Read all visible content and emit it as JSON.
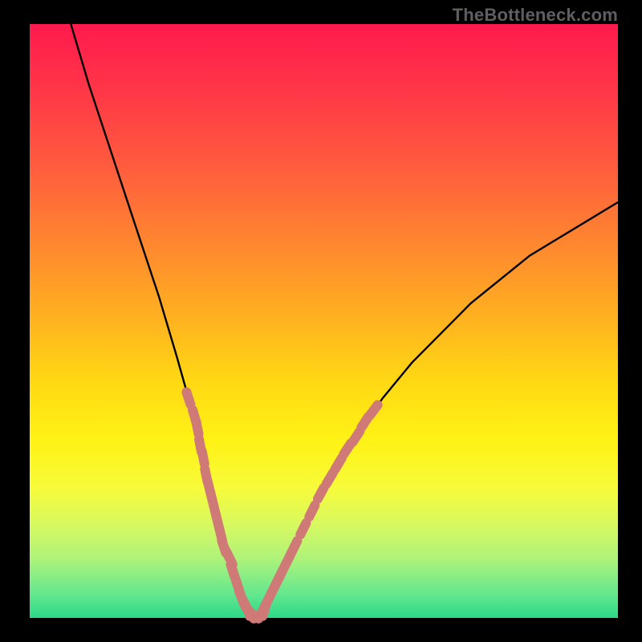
{
  "attribution": "TheBottleneck.com",
  "colors": {
    "background": "#000000",
    "gradient_top": "#ff1a4d",
    "gradient_mid": "#ffe025",
    "gradient_bottom": "#2cd988",
    "curve": "#000000",
    "markers": "#d07a78"
  },
  "chart_data": {
    "type": "line",
    "title": "",
    "xlabel": "",
    "ylabel": "",
    "xlim": [
      0,
      100
    ],
    "ylim": [
      0,
      100
    ],
    "grid": false,
    "legend": false,
    "series": [
      {
        "name": "bottleneck-curve",
        "x": [
          7,
          10,
          14,
          18,
          22,
          25,
          27,
          29,
          31,
          32.5,
          34,
          35.5,
          37,
          38.5,
          40,
          42,
          45,
          50,
          55,
          60,
          65,
          70,
          75,
          80,
          85,
          90,
          95,
          100
        ],
        "y": [
          100,
          90,
          78,
          66,
          54,
          44,
          37,
          29,
          21,
          15,
          10,
          6,
          2,
          0,
          2,
          6,
          12,
          22,
          30,
          37,
          43,
          48,
          53,
          57,
          61,
          64,
          67,
          70
        ]
      }
    ],
    "marker_clusters": [
      {
        "name": "left-cluster",
        "x": [
          27,
          28,
          28.5,
          29,
          29.5,
          30,
          30.5,
          31,
          31.5,
          32,
          32.5,
          33,
          33.5,
          34
        ],
        "y": [
          37,
          34,
          32,
          29,
          27,
          24,
          22,
          20,
          18,
          16,
          14,
          12,
          11,
          10
        ]
      },
      {
        "name": "bottom-cluster",
        "x": [
          34.5,
          35,
          35.5,
          36,
          36.5,
          37,
          37.5,
          38,
          38.5,
          39,
          39.5,
          40,
          40.5,
          41,
          41.5,
          42,
          42.5
        ],
        "y": [
          8,
          6.5,
          5,
          3.5,
          2.5,
          1.5,
          1,
          0.5,
          0.3,
          0.5,
          1,
          2,
          3,
          4,
          5,
          6,
          7
        ]
      },
      {
        "name": "right-cluster",
        "x": [
          43,
          44,
          45,
          46.5,
          48,
          49.5,
          51,
          52.5,
          54,
          55.5,
          57,
          58.5
        ],
        "y": [
          8,
          10,
          12,
          15,
          18,
          21,
          23.5,
          26,
          28.5,
          30.5,
          33,
          35
        ]
      }
    ],
    "notes": "V-shaped bottleneck curve on a rainbow heat background. Axis has no visible tick labels; x and y values estimated as 0–100 percent of plot width/height (y=0 at bottom). Pink marker clusters highlight low-bottleneck region near the valley."
  }
}
